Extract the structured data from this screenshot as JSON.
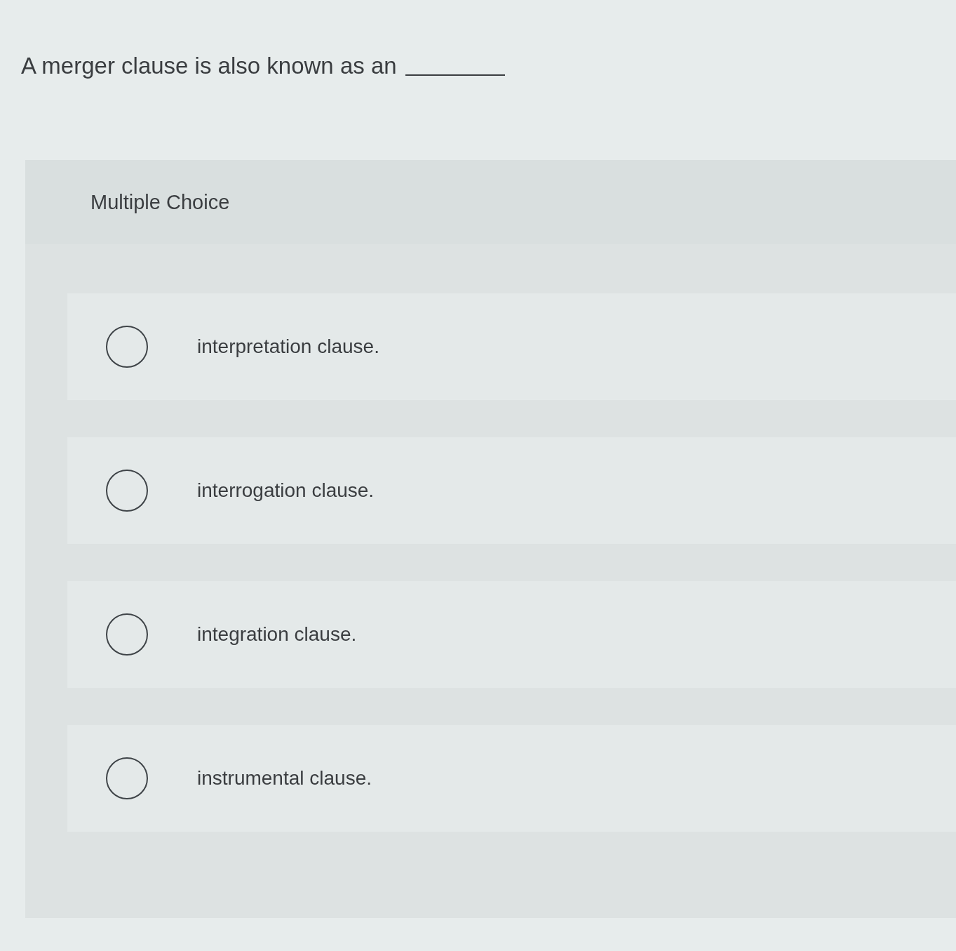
{
  "question": {
    "text": "A merger clause is also known as an"
  },
  "choices": {
    "heading": "Multiple Choice",
    "options": [
      {
        "label": "interpretation clause.",
        "selected": false
      },
      {
        "label": "interrogation clause.",
        "selected": false
      },
      {
        "label": "integration clause.",
        "selected": false
      },
      {
        "label": "instrumental clause.",
        "selected": false
      }
    ]
  }
}
